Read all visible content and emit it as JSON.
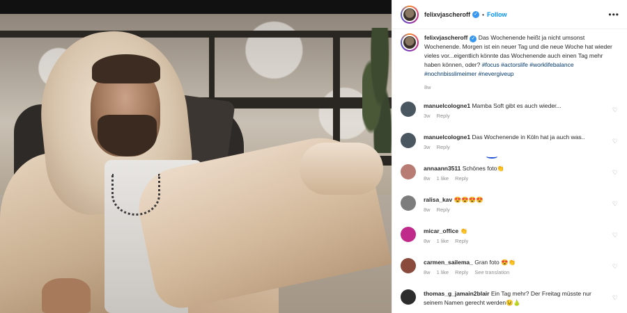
{
  "post": {
    "username": "felixvjascheroff",
    "separator": "•",
    "follow_label": "Follow",
    "more_label": "•••",
    "verified_mark": "✓"
  },
  "caption": {
    "username": "felixvjascheroff",
    "text": "Das Wochenende heißt ja nicht umsonst Wochenende. Morgen ist ein neuer Tag und die neue Woche hat wieder vieles vor...eigentlich könnte das Wochenende auch einen Tag mehr haben können, oder?",
    "tags": [
      "#focus",
      "#actorslife",
      "#worklifebalance",
      "#nochnbisslimeimer",
      "#nevergiveup"
    ],
    "age": "8w"
  },
  "comments": [
    {
      "username": "manuelcologne1",
      "text": "Mamba Soft gibt es auch wieder...",
      "age": "3w",
      "likes": "",
      "reply": "Reply",
      "avatar_color": "#4a5660"
    },
    {
      "username": "manuelcologne1",
      "text": "Das Wochenende in Köln hat ja auch was..",
      "age": "3w",
      "likes": "",
      "reply": "Reply",
      "avatar_color": "#4a5660"
    },
    {
      "username": "annaann3511",
      "text": "Schönes foto👏",
      "age": "8w",
      "likes": "1 like",
      "reply": "Reply",
      "avatar_color": "#b87c74"
    },
    {
      "username": "ralisa_kav",
      "text": "😍😍😍😍",
      "age": "8w",
      "likes": "",
      "reply": "Reply",
      "avatar_color": "#7d7d7d"
    },
    {
      "username": "micar_office",
      "text": "👏",
      "age": "8w",
      "likes": "1 like",
      "reply": "Reply",
      "avatar_color": "#c02a8a"
    },
    {
      "username": "carmen_sailema_",
      "text": "Gran foto 😍👏",
      "age": "8w",
      "likes": "1 like",
      "reply": "Reply",
      "translation": "See translation",
      "avatar_color": "#8a4a3c"
    },
    {
      "username": "thomas_g_jamain2blair",
      "text": "Ein Tag mehr? Der Freitag müsste nur seinem Namen gerecht werden😉🍐",
      "age": "",
      "likes": "",
      "reply": "",
      "avatar_color": "#2c2c2c"
    }
  ],
  "icons": {
    "heart": "♡"
  },
  "colors": {
    "accent_blue": "#0095f6",
    "hashtag": "#00376b",
    "meta_gray": "#8e8e8e"
  }
}
